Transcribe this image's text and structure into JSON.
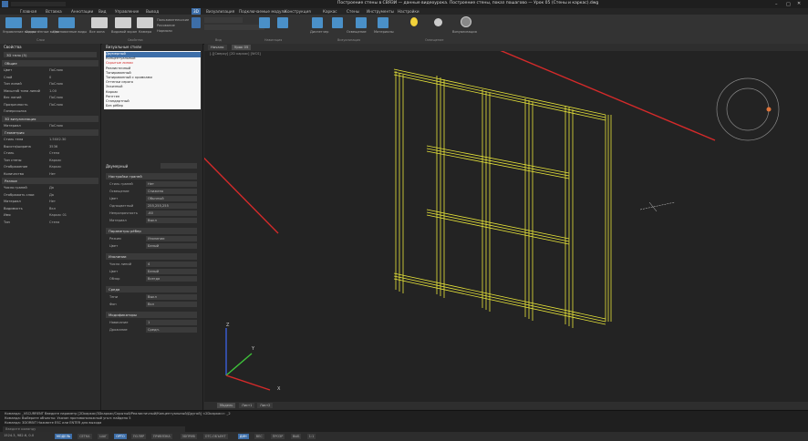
{
  "title": {
    "text": "Построение стены в СВЯЗИ — данные видеоурока. Построение стены, показ пошагово — Урок 05 (Стены и каркас).dwg"
  },
  "menu": [
    "Главная",
    "Вставка",
    "Аннотации",
    "Вид",
    "Управление",
    "Вывод",
    "3D",
    "Визуализация",
    "Подключаемые модули",
    "Конструкция",
    "Каркас",
    "Стены",
    "Инструменты",
    "Настройки"
  ],
  "ribbon": {
    "groups": [
      "Слои",
      "Свойства",
      "Вид",
      "Навигация",
      "Визуализация",
      "Виды",
      "Материалы",
      "Освещение"
    ],
    "labels": [
      "Управление видом",
      "Сохранённые виды",
      "Именованные виды",
      "Все окна",
      "Видовой экран",
      "Камера",
      "Диспетчер",
      "Освещение",
      "Материалы",
      "Визуализация"
    ],
    "small_labels": [
      "Пользовательские",
      "Рисование",
      "Нормали",
      "Выбор"
    ]
  },
  "properties": {
    "header": "Свойства",
    "selector": "3D тело (5)",
    "sections": [
      {
        "name": "Общие",
        "rows": [
          [
            "Цвет",
            "ПоСлою"
          ],
          [
            "Слой",
            "0"
          ],
          [
            "Тип линий",
            "ПоСлою"
          ],
          [
            "Масштаб типа линий",
            "1.00"
          ],
          [
            "Вес линий",
            "ПоСлою"
          ],
          [
            "Прозрачность",
            "ПоСлою"
          ],
          [
            "Гиперссылка",
            ""
          ]
        ]
      },
      {
        "name": "3D визуализация",
        "rows": [
          [
            "Материал",
            "ПоСлою"
          ]
        ]
      },
      {
        "name": "Геометрия",
        "rows": [
          [
            "Стиль тела",
            "1.50Х2.30"
          ],
          [
            "Высота/ширина",
            "3536"
          ],
          [
            "Стиль",
            "Стена"
          ],
          [
            "Тип стены",
            "Каркас"
          ],
          [
            "Отображение",
            "Каркас"
          ],
          [
            "Количество",
            "Нет"
          ]
        ]
      },
      {
        "name": "Разное",
        "rows": [
          [
            "Число граней",
            "Да"
          ],
          [
            "Отображать слои",
            "Да"
          ],
          [
            "Материал",
            "Нет"
          ],
          [
            "Видимость",
            "Вкл"
          ],
          [
            "Имя",
            "Каркас 01"
          ],
          [
            "Тип",
            "Стена"
          ]
        ]
      }
    ]
  },
  "layers": {
    "header": "Визуальные стили",
    "items": [
      "Двумерный",
      "Концептуальный",
      "Скрытые линии",
      "Реалистичный",
      "Тонированный",
      "Тонированный с кромками",
      "Оттенки серого",
      "Эскизный",
      "Каркас",
      "Рентген",
      "Стандартный",
      "Без рёбер"
    ],
    "selected_index": 0,
    "highlighted_index": 2
  },
  "style_props": {
    "header": "Двумерный",
    "sections": [
      {
        "name": "Настройки граней",
        "rows": [
          [
            "Стиль граней",
            "Нет"
          ],
          [
            "Освещение",
            "Снижено"
          ],
          [
            "Цвет",
            "Обычный"
          ],
          [
            "Одноцветный",
            "255,255,255"
          ],
          [
            "Непрозрачность",
            "-60"
          ],
          [
            "Материал",
            "Выкл"
          ]
        ]
      },
      {
        "name": "Параметры рёбер",
        "rows": [
          [
            "Режим",
            "Изолинии"
          ],
          [
            "Цвет",
            "Белый"
          ]
        ]
      },
      {
        "name": "Изолинии",
        "rows": [
          [
            "Число линий",
            "4"
          ],
          [
            "Цвет",
            "Белый"
          ],
          [
            "Обзор",
            "Всегда"
          ]
        ]
      },
      {
        "name": "Среда",
        "rows": [
          [
            "Тени",
            "Выкл"
          ],
          [
            "Фон",
            "Вкл"
          ]
        ]
      },
      {
        "name": "Модификаторы",
        "rows": [
          [
            "Нависание",
            "1"
          ],
          [
            "Дрожание",
            "Средн."
          ]
        ]
      }
    ]
  },
  "viewport": {
    "tabs": [
      "Начало",
      "Урок 05"
    ],
    "controls": [
      "[-][Сверху]",
      "[2D каркас]",
      "[WCS]"
    ],
    "axes": {
      "x": "X",
      "y": "Y",
      "z": "Z"
    }
  },
  "layout_tabs": [
    "Модель",
    "Лист1",
    "Лист2"
  ],
  "command_lines": [
    "Команда: _VSCURRENT Введите параметр [2Dкаркас/3Dкаркас/Скрытый/Реалистичный/Концептуальный/Другой] <2Dкаркас>: _2",
    "Команда: Выберите объекты: Указан противоположный угол: найдено 5",
    "Команда: 3DORBIT  Нажмите ESC или ENTER для выхода",
    "Введите команду"
  ],
  "status": {
    "coords": "1524.3, 982.6, 0.0",
    "buttons": [
      "МОДЕЛЬ",
      "СЕТКА",
      "ШАГ",
      "ОРТО",
      "ПОЛЯР",
      "ПРИВЯЗКА",
      "3DПРИВ",
      "ОТС-ОБЪЕКТ",
      "ДИН",
      "ВЕС",
      "ПРОЗР",
      "ВЫБ",
      "1:1"
    ],
    "active": [
      0,
      3,
      8
    ]
  },
  "colors": {
    "accent": "#3d6ea8",
    "model": "#e8e53a",
    "annotation": "#d42a2a"
  }
}
